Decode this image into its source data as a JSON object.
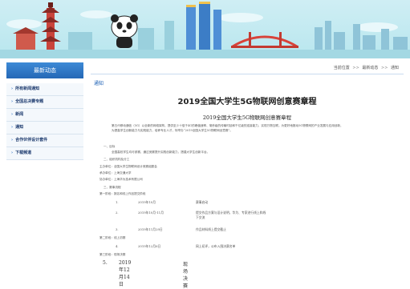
{
  "sidebar": {
    "title": "最新动态",
    "items": [
      {
        "label": "所有新闻通知"
      },
      {
        "label": "全国总决赛专题"
      },
      {
        "label": "新闻"
      },
      {
        "label": "通知"
      },
      {
        "label": "合作伙伴设计套件"
      },
      {
        "label": "下载频道"
      }
    ]
  },
  "breadcrumb": {
    "prefix": "当前位置",
    "items": [
      "最新动态",
      "通知"
    ],
    "separator": ">>"
  },
  "section_title": "通知",
  "article": {
    "title": "2019全国大学生5G物联网创意赛章程",
    "subtitle": "2019全国大学生5G物联网创意赛章程",
    "intro_lines": [
      "第五代移动通信（5G）以全新的网络架构，提供至少十倍于4G的峰值速率、毫秒级的传输时延和千亿级的连接能力，实现万物互联。为更好地推动5G物联网的产业发展与应用创新，",
      "为提高学生创新能力与实践能力，培养专业人才，特举办“2019全国大学生5G物联网创意赛”。"
    ],
    "goal_heading": "一、目标",
    "goal_text": "全国高校学生均可参赛，通过竞赛提升实践创新能力，搭建大学生创新平台。",
    "org_heading": "二、组织机构及分工",
    "org_lines": [
      "主办单位：全国大学生物联网设计竞赛组委会",
      "承办单位：上海交通大学",
      "协办单位：上海华为技术有限公司"
    ],
    "sched_heading": "三、赛事流程",
    "stage1": "第一阶段：报名和线上作品提交阶段",
    "schedule": [
      {
        "n": "1.",
        "d": "2019年10月",
        "t": "赛事启动"
      },
      {
        "n": "2.",
        "d": "2019年10月-11月",
        "t": "提交作品方案与设计说明，华为、专家进行线上和线下交流"
      },
      {
        "n": "3.",
        "d": "2019年11月29日",
        "t": "作品材料线上提交截止"
      }
    ],
    "stage2": "第二阶段：线上初赛",
    "schedule2": [
      {
        "n": "4.",
        "d": "2019年12月6日",
        "t": "网上初评，公布入围决赛名单"
      }
    ],
    "stage3": "第三阶段：现场决赛",
    "final_row": {
      "n": "5.",
      "d": "2019年12月14日",
      "t": "现场决赛"
    }
  },
  "colors": {
    "sidebar_head": "#2f7ac8",
    "link": "#1a5fb4",
    "banner_sky": "#c6ebf2"
  }
}
